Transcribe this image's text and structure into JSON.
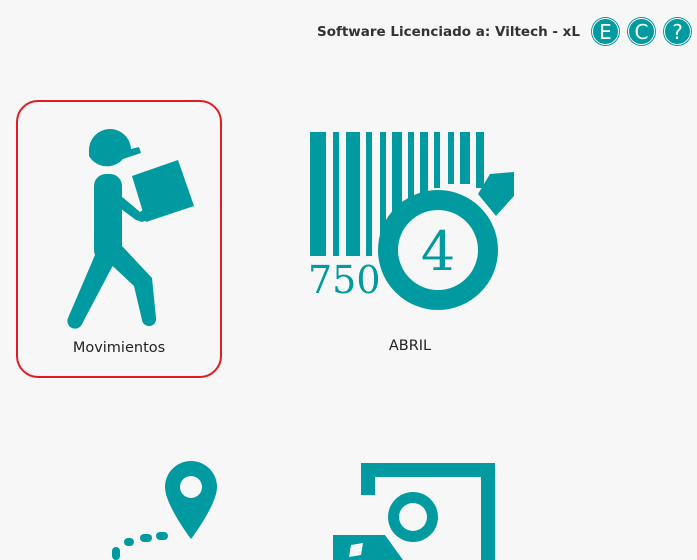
{
  "header": {
    "license_text": "Software Licenciado a: Viltech - xL",
    "buttons": [
      {
        "label": "E"
      },
      {
        "label": "C"
      },
      {
        "label": "?"
      }
    ]
  },
  "tiles": [
    {
      "label": "Movimientos",
      "icon": "walking-worker-icon",
      "selected": true
    },
    {
      "label": "ABRIL",
      "icon": "barcode-month-icon",
      "barcode_number": "750",
      "badge_number": "4"
    },
    {
      "label": "",
      "icon": "route-pin-icon"
    },
    {
      "label": "",
      "icon": "document-image-icon"
    }
  ],
  "colors": {
    "accent": "#009aa0",
    "selection_border": "#e01b22",
    "background": "#f7f7f7"
  }
}
